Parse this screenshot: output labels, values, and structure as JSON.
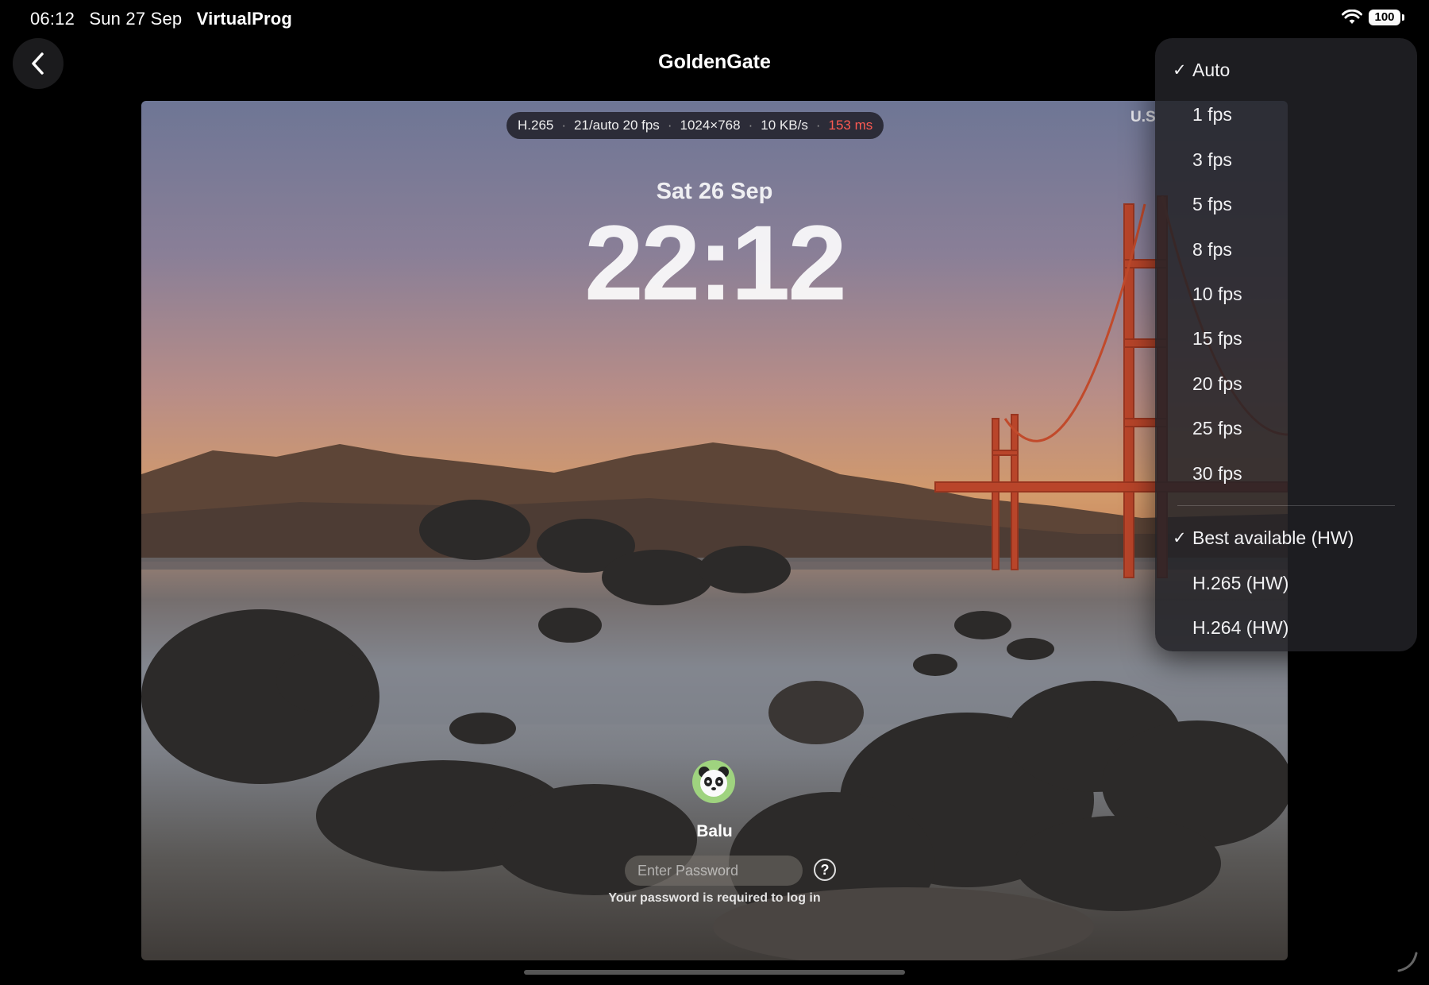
{
  "status_bar": {
    "time": "06:12",
    "date": "Sun 27 Sep",
    "app_name": "VirtualProg",
    "battery": "100"
  },
  "nav": {
    "title": "GoldenGate"
  },
  "stream_stats": {
    "codec": "H.265",
    "fps": "21/auto 20 fps",
    "resolution": "1024×768",
    "bitrate": "10 KB/s",
    "latency": "153 ms",
    "latency_color": "#ff5a52"
  },
  "remote_screen": {
    "input_indicator": "U.S",
    "lock_date": "Sat 26 Sep",
    "lock_time": "22:12",
    "username": "Balu",
    "password_placeholder": "Enter Password",
    "help_glyph": "?",
    "password_hint": "Your password is required to log in"
  },
  "menu": {
    "check_glyph": "✓",
    "framerate_items": [
      {
        "label": "Auto",
        "selected": true
      },
      {
        "label": "1 fps",
        "selected": false
      },
      {
        "label": "3 fps",
        "selected": false
      },
      {
        "label": "5 fps",
        "selected": false
      },
      {
        "label": "8 fps",
        "selected": false
      },
      {
        "label": "10 fps",
        "selected": false
      },
      {
        "label": "15 fps",
        "selected": false
      },
      {
        "label": "20 fps",
        "selected": false
      },
      {
        "label": "25 fps",
        "selected": false
      },
      {
        "label": "30 fps",
        "selected": false
      }
    ],
    "codec_items": [
      {
        "label": "Best available (HW)",
        "selected": true
      },
      {
        "label": "H.265 (HW)",
        "selected": false
      },
      {
        "label": "H.264 (HW)",
        "selected": false
      }
    ]
  },
  "icons": {
    "back": "chevron-left-icon",
    "wifi": "wifi-icon",
    "battery": "battery-icon",
    "avatar": "panda-avatar-icon",
    "help": "question-mark-icon"
  }
}
